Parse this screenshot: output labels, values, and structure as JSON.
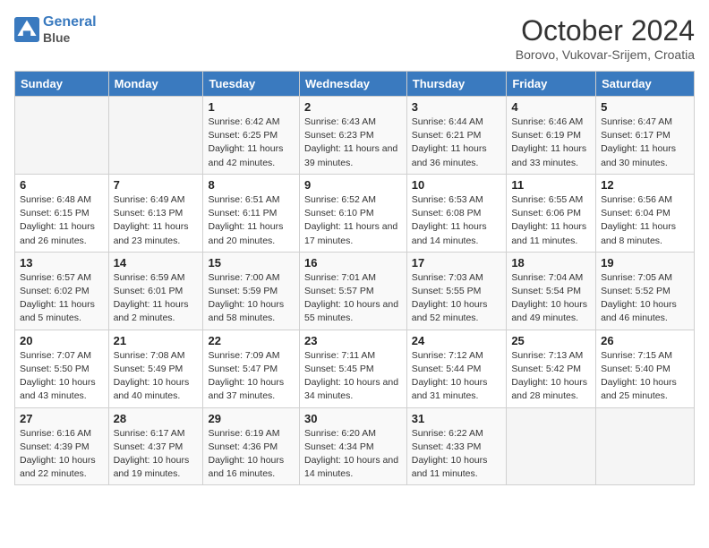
{
  "header": {
    "logo_line1": "General",
    "logo_line2": "Blue",
    "month": "October 2024",
    "location": "Borovo, Vukovar-Srijem, Croatia"
  },
  "days_of_week": [
    "Sunday",
    "Monday",
    "Tuesday",
    "Wednesday",
    "Thursday",
    "Friday",
    "Saturday"
  ],
  "weeks": [
    [
      {
        "day": "",
        "sunrise": "",
        "sunset": "",
        "daylight": ""
      },
      {
        "day": "",
        "sunrise": "",
        "sunset": "",
        "daylight": ""
      },
      {
        "day": "1",
        "sunrise": "Sunrise: 6:42 AM",
        "sunset": "Sunset: 6:25 PM",
        "daylight": "Daylight: 11 hours and 42 minutes."
      },
      {
        "day": "2",
        "sunrise": "Sunrise: 6:43 AM",
        "sunset": "Sunset: 6:23 PM",
        "daylight": "Daylight: 11 hours and 39 minutes."
      },
      {
        "day": "3",
        "sunrise": "Sunrise: 6:44 AM",
        "sunset": "Sunset: 6:21 PM",
        "daylight": "Daylight: 11 hours and 36 minutes."
      },
      {
        "day": "4",
        "sunrise": "Sunrise: 6:46 AM",
        "sunset": "Sunset: 6:19 PM",
        "daylight": "Daylight: 11 hours and 33 minutes."
      },
      {
        "day": "5",
        "sunrise": "Sunrise: 6:47 AM",
        "sunset": "Sunset: 6:17 PM",
        "daylight": "Daylight: 11 hours and 30 minutes."
      }
    ],
    [
      {
        "day": "6",
        "sunrise": "Sunrise: 6:48 AM",
        "sunset": "Sunset: 6:15 PM",
        "daylight": "Daylight: 11 hours and 26 minutes."
      },
      {
        "day": "7",
        "sunrise": "Sunrise: 6:49 AM",
        "sunset": "Sunset: 6:13 PM",
        "daylight": "Daylight: 11 hours and 23 minutes."
      },
      {
        "day": "8",
        "sunrise": "Sunrise: 6:51 AM",
        "sunset": "Sunset: 6:11 PM",
        "daylight": "Daylight: 11 hours and 20 minutes."
      },
      {
        "day": "9",
        "sunrise": "Sunrise: 6:52 AM",
        "sunset": "Sunset: 6:10 PM",
        "daylight": "Daylight: 11 hours and 17 minutes."
      },
      {
        "day": "10",
        "sunrise": "Sunrise: 6:53 AM",
        "sunset": "Sunset: 6:08 PM",
        "daylight": "Daylight: 11 hours and 14 minutes."
      },
      {
        "day": "11",
        "sunrise": "Sunrise: 6:55 AM",
        "sunset": "Sunset: 6:06 PM",
        "daylight": "Daylight: 11 hours and 11 minutes."
      },
      {
        "day": "12",
        "sunrise": "Sunrise: 6:56 AM",
        "sunset": "Sunset: 6:04 PM",
        "daylight": "Daylight: 11 hours and 8 minutes."
      }
    ],
    [
      {
        "day": "13",
        "sunrise": "Sunrise: 6:57 AM",
        "sunset": "Sunset: 6:02 PM",
        "daylight": "Daylight: 11 hours and 5 minutes."
      },
      {
        "day": "14",
        "sunrise": "Sunrise: 6:59 AM",
        "sunset": "Sunset: 6:01 PM",
        "daylight": "Daylight: 11 hours and 2 minutes."
      },
      {
        "day": "15",
        "sunrise": "Sunrise: 7:00 AM",
        "sunset": "Sunset: 5:59 PM",
        "daylight": "Daylight: 10 hours and 58 minutes."
      },
      {
        "day": "16",
        "sunrise": "Sunrise: 7:01 AM",
        "sunset": "Sunset: 5:57 PM",
        "daylight": "Daylight: 10 hours and 55 minutes."
      },
      {
        "day": "17",
        "sunrise": "Sunrise: 7:03 AM",
        "sunset": "Sunset: 5:55 PM",
        "daylight": "Daylight: 10 hours and 52 minutes."
      },
      {
        "day": "18",
        "sunrise": "Sunrise: 7:04 AM",
        "sunset": "Sunset: 5:54 PM",
        "daylight": "Daylight: 10 hours and 49 minutes."
      },
      {
        "day": "19",
        "sunrise": "Sunrise: 7:05 AM",
        "sunset": "Sunset: 5:52 PM",
        "daylight": "Daylight: 10 hours and 46 minutes."
      }
    ],
    [
      {
        "day": "20",
        "sunrise": "Sunrise: 7:07 AM",
        "sunset": "Sunset: 5:50 PM",
        "daylight": "Daylight: 10 hours and 43 minutes."
      },
      {
        "day": "21",
        "sunrise": "Sunrise: 7:08 AM",
        "sunset": "Sunset: 5:49 PM",
        "daylight": "Daylight: 10 hours and 40 minutes."
      },
      {
        "day": "22",
        "sunrise": "Sunrise: 7:09 AM",
        "sunset": "Sunset: 5:47 PM",
        "daylight": "Daylight: 10 hours and 37 minutes."
      },
      {
        "day": "23",
        "sunrise": "Sunrise: 7:11 AM",
        "sunset": "Sunset: 5:45 PM",
        "daylight": "Daylight: 10 hours and 34 minutes."
      },
      {
        "day": "24",
        "sunrise": "Sunrise: 7:12 AM",
        "sunset": "Sunset: 5:44 PM",
        "daylight": "Daylight: 10 hours and 31 minutes."
      },
      {
        "day": "25",
        "sunrise": "Sunrise: 7:13 AM",
        "sunset": "Sunset: 5:42 PM",
        "daylight": "Daylight: 10 hours and 28 minutes."
      },
      {
        "day": "26",
        "sunrise": "Sunrise: 7:15 AM",
        "sunset": "Sunset: 5:40 PM",
        "daylight": "Daylight: 10 hours and 25 minutes."
      }
    ],
    [
      {
        "day": "27",
        "sunrise": "Sunrise: 6:16 AM",
        "sunset": "Sunset: 4:39 PM",
        "daylight": "Daylight: 10 hours and 22 minutes."
      },
      {
        "day": "28",
        "sunrise": "Sunrise: 6:17 AM",
        "sunset": "Sunset: 4:37 PM",
        "daylight": "Daylight: 10 hours and 19 minutes."
      },
      {
        "day": "29",
        "sunrise": "Sunrise: 6:19 AM",
        "sunset": "Sunset: 4:36 PM",
        "daylight": "Daylight: 10 hours and 16 minutes."
      },
      {
        "day": "30",
        "sunrise": "Sunrise: 6:20 AM",
        "sunset": "Sunset: 4:34 PM",
        "daylight": "Daylight: 10 hours and 14 minutes."
      },
      {
        "day": "31",
        "sunrise": "Sunrise: 6:22 AM",
        "sunset": "Sunset: 4:33 PM",
        "daylight": "Daylight: 10 hours and 11 minutes."
      },
      {
        "day": "",
        "sunrise": "",
        "sunset": "",
        "daylight": ""
      },
      {
        "day": "",
        "sunrise": "",
        "sunset": "",
        "daylight": ""
      }
    ]
  ]
}
